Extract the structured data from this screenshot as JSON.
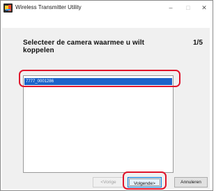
{
  "window": {
    "title": "Wireless Transmitter Utility",
    "controls": {
      "minimize": "–",
      "maximize": "□",
      "close": "✕"
    }
  },
  "page": {
    "instruction": "Selecteer de camera waarmee u wilt koppelen",
    "step": "1/5"
  },
  "camera_list": {
    "items": [
      "7777_0001286"
    ],
    "selected_index": 0
  },
  "buttons": {
    "prev_label": "<Vorige",
    "next_label": "Volgende>",
    "cancel_label": "Annuleren"
  },
  "colors": {
    "selection": "#1c63c9",
    "highlight": "#e0142b",
    "panel_bg": "#f0f0f0"
  }
}
